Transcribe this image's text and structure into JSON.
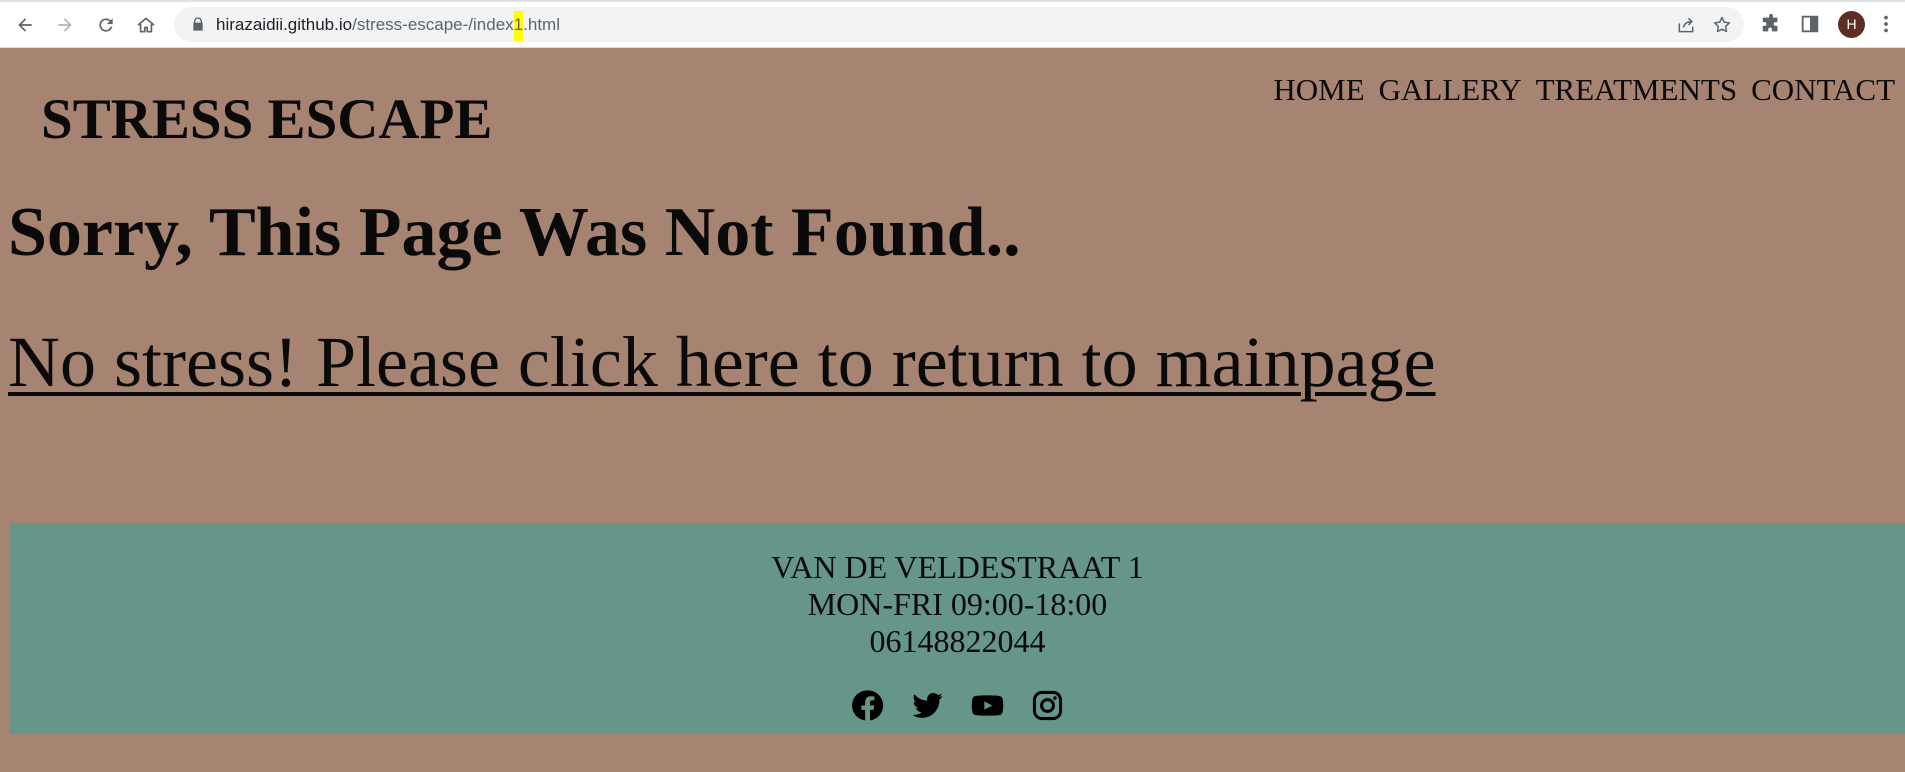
{
  "browser": {
    "url_host": "hirazaidii.github.io",
    "url_path_before_mark": "/stress-escape-/index",
    "url_path_marked": "1",
    "url_path_after_mark": ".html",
    "avatar_initial": "H",
    "icons": [
      "back-icon",
      "forward-icon",
      "reload-icon",
      "home-icon",
      "lock-icon",
      "share-icon",
      "bookmark-star-icon",
      "extensions-icon",
      "side-panel-icon",
      "menu-dots-icon"
    ]
  },
  "site": {
    "logo": "STRESS ESCAPE",
    "nav": [
      "HOME",
      "GALLERY",
      "TREATMENTS",
      "CONTACT"
    ],
    "heading": "Sorry, This Page Was Not Found..",
    "return_link": "No stress! Please click here to return to mainpage"
  },
  "footer": {
    "lines": [
      "VAN DE VELDESTRAAT 1",
      "MON-FRI 09:00-18:00",
      "06148822044"
    ],
    "social_icons": [
      "facebook-icon",
      "twitter-icon",
      "youtube-icon",
      "instagram-icon"
    ]
  },
  "colors": {
    "page_background": "#a68471",
    "footer_background": "#66958a",
    "url_highlight": "#ffff00",
    "avatar": "#5e2e24"
  }
}
